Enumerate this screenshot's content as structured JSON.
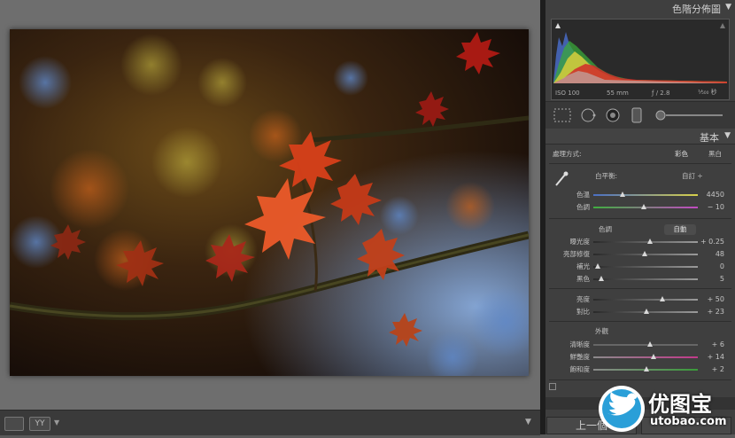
{
  "panel": {
    "histogram_title": "色階分佈圖",
    "basic_title": "基本",
    "collapse_arrow": "▼"
  },
  "histogram": {
    "iso": "ISO 100",
    "focal": "55 mm",
    "aperture": "ƒ / 2.8",
    "shutter": "¹⁄₅₀₀ 秒"
  },
  "treatment": {
    "label": "處理方式:",
    "color": "彩色",
    "bw": "黑白"
  },
  "white_balance": {
    "label": "白平衡:",
    "value": "自訂 ÷"
  },
  "wb_sliders": [
    {
      "label": "色溫",
      "value": "4450",
      "pos": 0.28,
      "gradient": "linear-gradient(90deg,#4a6fc4,#d7d04a)"
    },
    {
      "label": "色調",
      "value": "− 10",
      "pos": 0.48,
      "gradient": "linear-gradient(90deg,#3fae3f,#c24ac2)"
    }
  ],
  "tone": {
    "label": "色調",
    "auto": "自動"
  },
  "tone_sliders": [
    {
      "label": "曝光度",
      "value": "+ 0.25",
      "pos": 0.54
    },
    {
      "label": "亮部修復",
      "value": "48",
      "pos": 0.49
    },
    {
      "label": "補光",
      "value": "0",
      "pos": 0.04
    },
    {
      "label": "黑色",
      "value": "5",
      "pos": 0.08
    }
  ],
  "presence_sliders1": [
    {
      "label": "亮度",
      "value": "+ 50",
      "pos": 0.66
    },
    {
      "label": "對比",
      "value": "+ 23",
      "pos": 0.51
    }
  ],
  "presence": {
    "label": "外觀"
  },
  "presence_sliders2": [
    {
      "label": "清晰度",
      "value": "+ 6",
      "pos": 0.54,
      "gradient": "linear-gradient(90deg,#666,#666)"
    },
    {
      "label": "鮮艷度",
      "value": "+ 14",
      "pos": 0.58,
      "gradient": "linear-gradient(90deg,#8a8a8a,#c23a8a)"
    },
    {
      "label": "飽和度",
      "value": "+ 2",
      "pos": 0.51,
      "gradient": "linear-gradient(90deg,#8a8a8a,#3a9a3a)"
    }
  ],
  "nav": {
    "prev": "上一個"
  },
  "toolbar": {
    "view_label": "YY",
    "dropdown_arrow": "▼"
  },
  "watermark": {
    "brand": "优图宝",
    "url": "utobao.com"
  }
}
